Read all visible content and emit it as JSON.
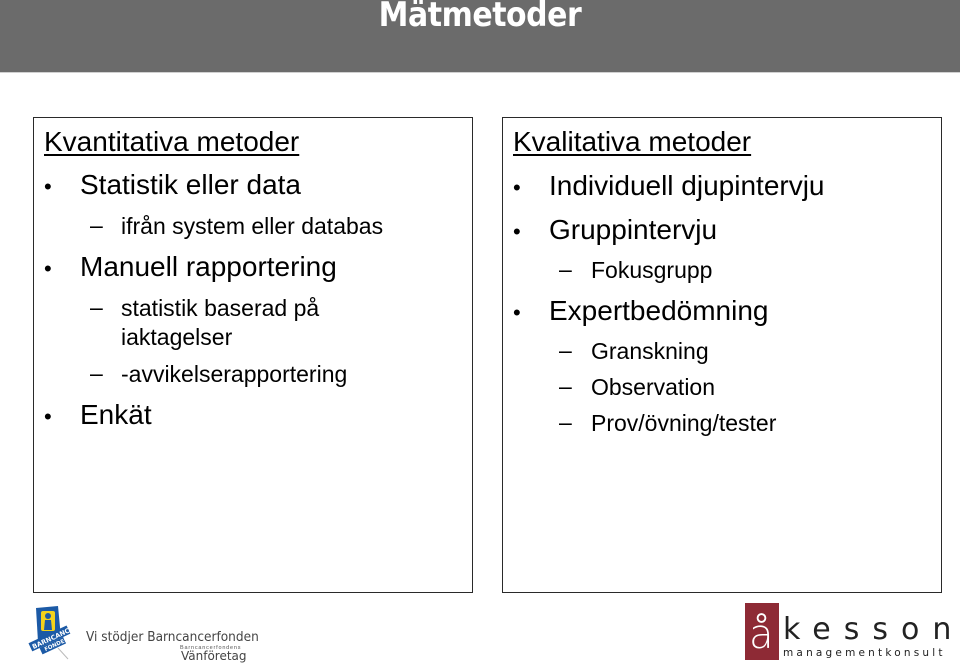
{
  "slide": {
    "title": "Mätmetoder"
  },
  "left_box": {
    "heading": "Kvantitativa metoder",
    "items": [
      {
        "text": "Statistik eller data",
        "level": 1
      },
      {
        "text": "ifrån system eller databas",
        "level": 2
      },
      {
        "text": "Manuell rapportering",
        "level": 1
      },
      {
        "text": "statistik baserad på",
        "level": 2
      },
      {
        "text": "iaktagelser",
        "level": 2,
        "continuation": true
      },
      {
        "text": "-avvikelserapportering",
        "level": 2
      },
      {
        "text": "Enkät",
        "level": 1
      }
    ]
  },
  "right_box": {
    "heading": "Kvalitativa metoder",
    "items": [
      {
        "text": "Individuell djupintervju",
        "level": 1
      },
      {
        "text": "Gruppintervju",
        "level": 1
      },
      {
        "text": "Fokusgrupp",
        "level": 2
      },
      {
        "text": "Expertbedömning",
        "level": 1
      },
      {
        "text": "Granskning",
        "level": 2
      },
      {
        "text": "Observation",
        "level": 2
      },
      {
        "text": "Prov/övning/tester",
        "level": 2
      }
    ]
  },
  "symbols": {
    "bullet": "•",
    "dash": "–"
  },
  "footer": {
    "barncancerfonden": {
      "logo_text": "BARNCANCER FONDEN",
      "tagline": "Vi stödjer Barncancerfonden",
      "small": "Barncancerfondens",
      "program": "Vänföretag"
    },
    "akesson": {
      "logo_letter": "å",
      "name": "kesson",
      "subtitle": "managementkonsult",
      "brand_color": "#8e2a35"
    }
  }
}
